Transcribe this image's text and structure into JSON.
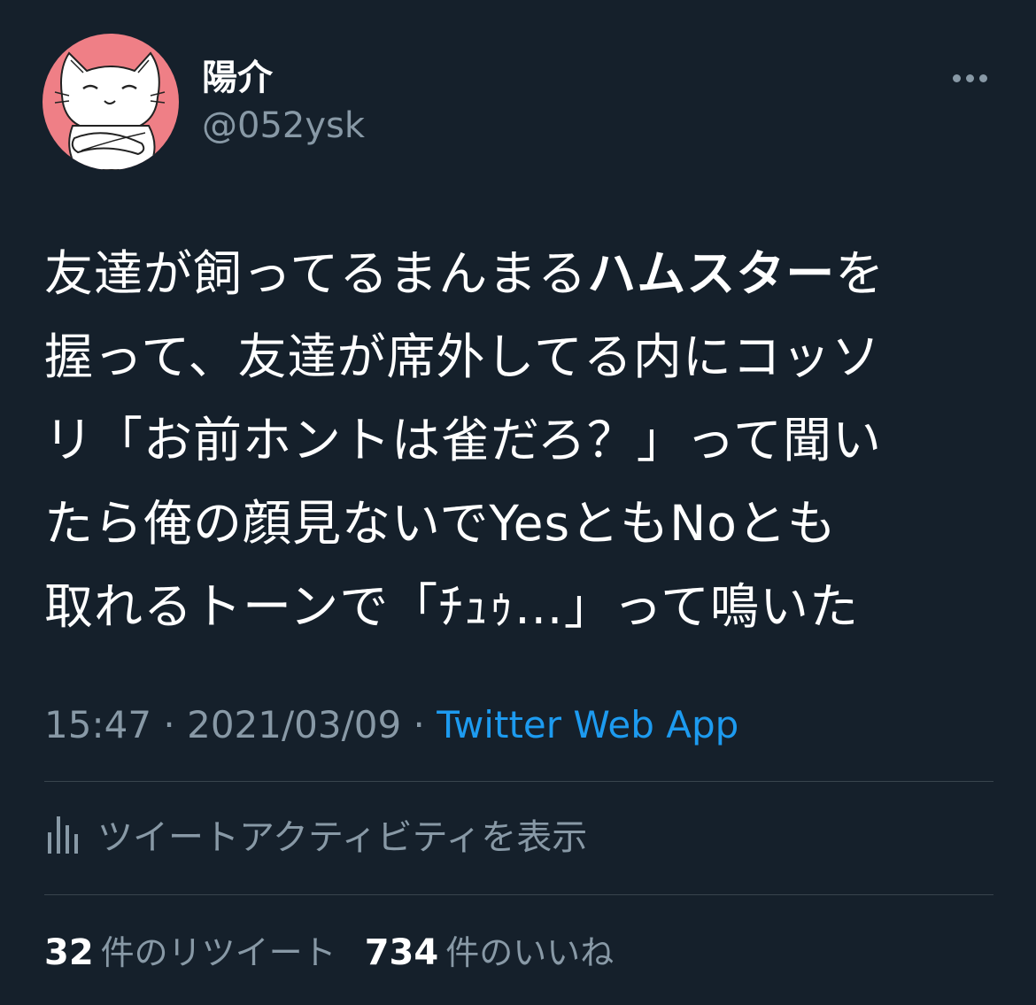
{
  "user": {
    "display_name": "陽介",
    "handle": "@052ysk",
    "avatar_icon": "cat-avatar-icon",
    "avatar_bg": "#ef7f86"
  },
  "more_icon": "more-horizontal-icon",
  "tweet": {
    "lines": [
      {
        "pre": "友達が飼ってるまんまる",
        "bold": "ハムスター",
        "post": "を"
      },
      {
        "text": "握って、友達が席外してる内にコッソ"
      },
      {
        "text": "リ「お前ホントは雀だろ？」って聞い"
      },
      {
        "text": "たら俺の顔見ないでYesともNoとも"
      },
      {
        "text": "取れるトーンで「ﾁｭｩ…」って鳴いた"
      }
    ]
  },
  "meta": {
    "time": "15:47",
    "separator": " · ",
    "date": "2021/03/09",
    "source": "Twitter Web App"
  },
  "activity": {
    "icon": "bar-chart-icon",
    "label": "ツイートアクティビティを表示"
  },
  "stats": {
    "retweets_count": "32",
    "retweets_label": "件のリツイート",
    "likes_count": "734",
    "likes_label": "件のいいね"
  },
  "colors": {
    "background": "#15202b",
    "text": "#ffffff",
    "secondary": "#8899a6",
    "link": "#1d9bf0",
    "divider": "#38444d"
  }
}
